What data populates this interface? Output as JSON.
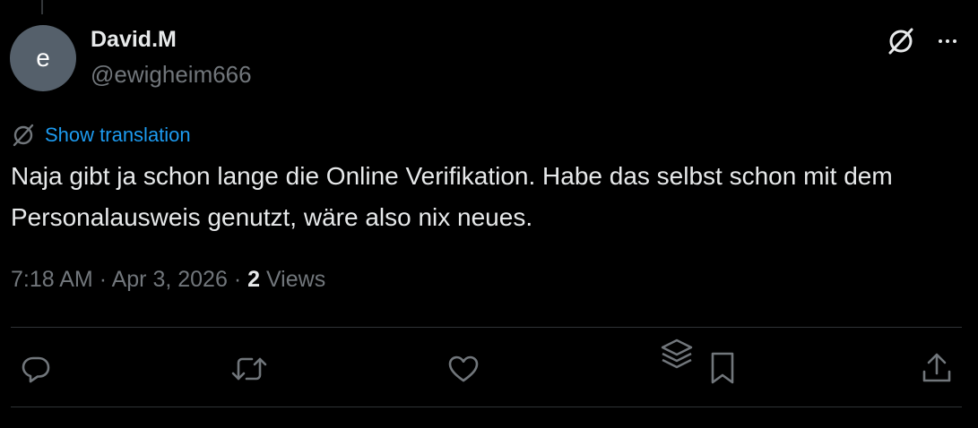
{
  "author": {
    "avatar_letter": "e",
    "display_name": "David.M",
    "handle": "@ewigheim666"
  },
  "translate": {
    "label": "Show translation"
  },
  "tweet": {
    "text": "Naja gibt ja schon lange die Online Verifikation. Habe das selbst schon mit dem Personalausweis genutzt, wäre also nix neues.",
    "time": "7:18 AM",
    "separator": "·",
    "date": "Apr 3, 2026",
    "views_count": "2",
    "views_label": "Views"
  },
  "icons": {
    "grok": "grok-icon",
    "more": "more-dots-icon",
    "translate": "translate-icon",
    "reply": "reply-icon",
    "repost": "repost-icon",
    "like": "like-icon",
    "layers": "layers-icon",
    "bookmark": "bookmark-icon",
    "share": "share-icon"
  },
  "colors": {
    "background": "#000000",
    "text_primary": "#e7e9ea",
    "text_secondary": "#71767b",
    "link": "#1d9bf0",
    "avatar_bg": "#55606b",
    "divider": "#2f3336"
  }
}
